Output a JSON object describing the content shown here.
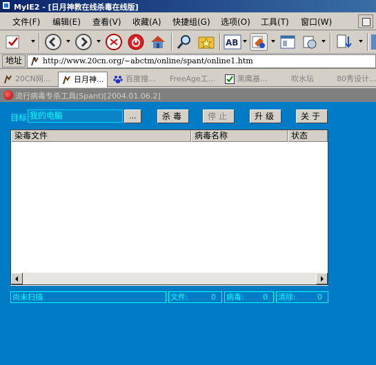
{
  "window": {
    "title": "MyIE2 - [日月神教在线杀毒在线版]"
  },
  "menu": {
    "items": [
      "文件(F)",
      "编辑(E)",
      "查看(V)",
      "收藏(A)",
      "快捷组(G)",
      "选项(O)",
      "工具(T)",
      "窗口(W)"
    ]
  },
  "toolbar": {
    "icons": [
      "check-icon",
      "back-icon",
      "forward-icon",
      "stop-icon",
      "refresh-icon",
      "home-icon",
      "search-icon",
      "favorites-icon",
      "text-size-icon",
      "proxy-icon",
      "view-icon",
      "print-icon",
      "download-icon"
    ]
  },
  "address": {
    "label": "地址",
    "url": "http://www.20cn.org/~abctm/online/spant/online1.htm"
  },
  "tabs": [
    {
      "label": "20CN网..."
    },
    {
      "label": "日月神..."
    },
    {
      "label": "百度搜..."
    },
    {
      "label": "FreeAge工..."
    },
    {
      "label": "黑鹰基..."
    },
    {
      "label": "吹水坛"
    },
    {
      "label": "80秀设计..."
    }
  ],
  "dialog": {
    "title": "流行病毒专杀工具(Spant)[2004.01.06.2]"
  },
  "scanner": {
    "target_label": "目标",
    "target_value": "我的电脑",
    "browse_label": "...",
    "buttons": {
      "kill": "杀毒",
      "stop": "停止",
      "upgrade": "升级",
      "about": "关于"
    },
    "columns": [
      "染毒文件",
      "病毒名称",
      "状态"
    ]
  },
  "status": {
    "message": "尚未扫描",
    "files_label": "文件:",
    "files_value": "0",
    "virus_label": "病毒:",
    "virus_value": "0",
    "cleaned_label": "清除:",
    "cleaned_value": "0"
  },
  "colors": {
    "panel_bg": "#007bc6",
    "accent_text": "#00ffff",
    "titlebar": "#0a246a"
  }
}
